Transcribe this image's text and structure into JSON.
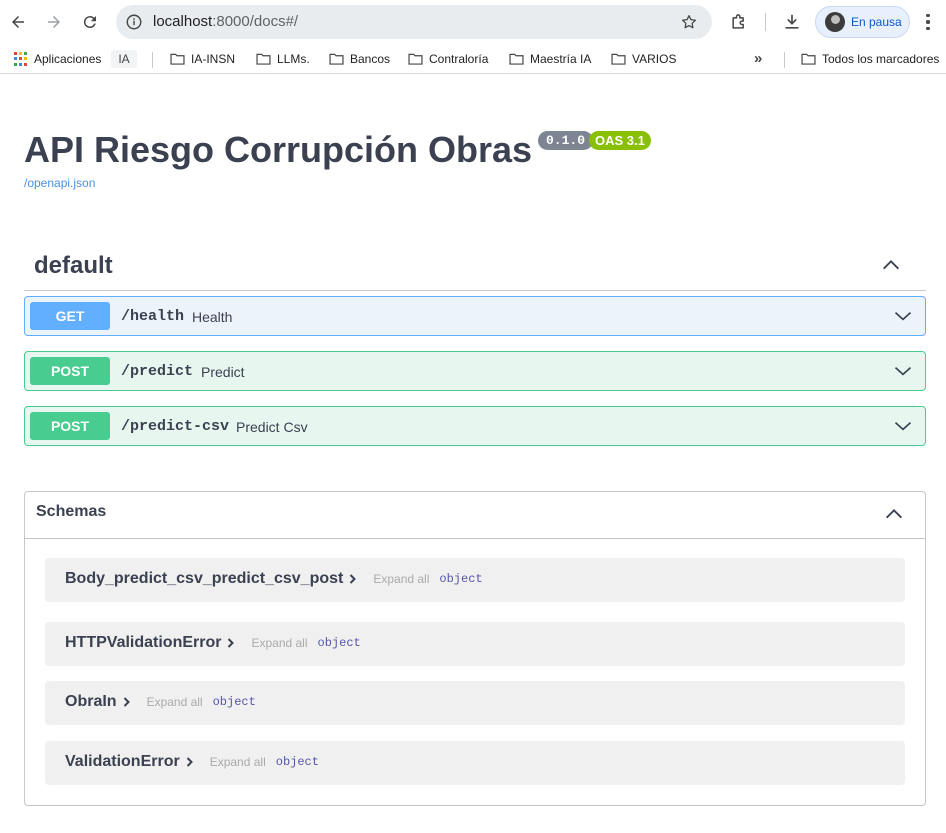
{
  "browser": {
    "url_host": "localhost",
    "url_rest": ":8000/docs#/",
    "profile_label": "En pausa"
  },
  "bookmarks": {
    "apps_label": "Aplicaciones",
    "ia_label": "IA",
    "items": [
      "IA-INSN",
      "LLMs.",
      "Bancos",
      "Contraloría",
      "Maestría IA",
      "VARIOS"
    ],
    "overflow": "»",
    "all_label": "Todos los marcadores"
  },
  "api": {
    "title": "API Riesgo Corrupción Obras",
    "version": "0.1.0",
    "oas": "OAS 3.1",
    "spec_link": "/openapi.json"
  },
  "tag": {
    "name": "default",
    "operations": [
      {
        "method": "GET",
        "path": "/health",
        "summary": "Health"
      },
      {
        "method": "POST",
        "path": "/predict",
        "summary": "Predict"
      },
      {
        "method": "POST",
        "path": "/predict-csv",
        "summary": "Predict Csv"
      }
    ]
  },
  "schemas": {
    "title": "Schemas",
    "expand_label": "Expand all",
    "models": [
      {
        "name": "Body_predict_csv_predict_csv_post",
        "type": "object"
      },
      {
        "name": "HTTPValidationError",
        "type": "object"
      },
      {
        "name": "ObraIn",
        "type": "object"
      },
      {
        "name": "ValidationError",
        "type": "object"
      }
    ]
  },
  "colors": {
    "get": "#61affe",
    "post": "#49cc90",
    "oas_badge": "#89bf04",
    "version_badge": "#7d8492"
  }
}
